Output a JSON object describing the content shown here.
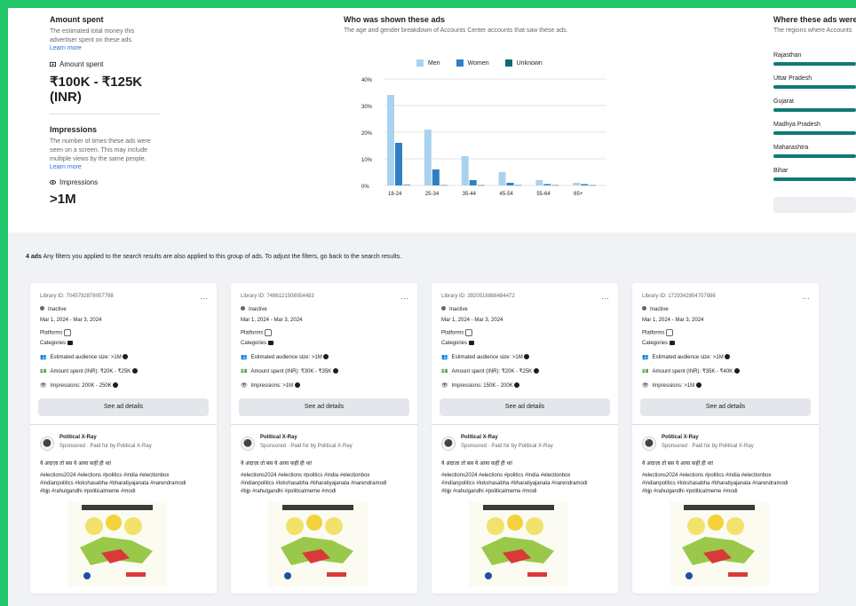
{
  "summary": {
    "amount_spent": {
      "title": "Amount spent",
      "description_1": "The estimated total money this",
      "description_2": "advertiser spent on these ads.",
      "learn_more": "Learn more",
      "label": "Amount spent",
      "value": "₹100K - ₹125K (INR)"
    },
    "impressions": {
      "title": "Impressions",
      "description_1": "The number of times these ads were",
      "description_2": "seen on a screen. This may include",
      "description_3": "multiple views by the same people.",
      "learn_more": "Learn more",
      "label": "Impressions",
      "value": ">1M"
    }
  },
  "chart": {
    "title": "Who was shown these ads",
    "subtitle": "The age and gender breakdown of Accounts Center accounts that saw these ads.",
    "legend": [
      "Men",
      "Women",
      "Unknown"
    ],
    "colors": {
      "Men": "#a9d2ef",
      "Women": "#2f7fc4",
      "Unknown": "#0e6a72",
      "grid": "#e4e6eb"
    }
  },
  "chart_data": {
    "type": "bar",
    "categories": [
      "18-24",
      "25-34",
      "35-44",
      "45-54",
      "55-64",
      "65+"
    ],
    "series": [
      {
        "name": "Men",
        "values": [
          34,
          21,
          11,
          5,
          2,
          1
        ]
      },
      {
        "name": "Women",
        "values": [
          16,
          6,
          2,
          1,
          0.5,
          0.5
        ]
      },
      {
        "name": "Unknown",
        "values": [
          0.2,
          0.1,
          0.1,
          0.1,
          0.1,
          0.1
        ]
      }
    ],
    "yticks": [
      "40%",
      "30%",
      "20%",
      "10%",
      "0%"
    ],
    "ylim": [
      0,
      40
    ],
    "grid": true,
    "legend_position": "top"
  },
  "regions": {
    "title": "Where these ads were",
    "subtitle": "The regions where Accounts",
    "items": [
      {
        "label": "Rajasthan"
      },
      {
        "label": "Uttar Pradesh"
      },
      {
        "label": "Gujarat"
      },
      {
        "label": "Madhya Pradesh"
      },
      {
        "label": "Maharashtra"
      },
      {
        "label": "Bihar"
      }
    ]
  },
  "filter_note": {
    "count": "4 ads",
    "text": "Any filters you applied to the search results are also applied to this group of ads. To adjust the filters, go back to the search results."
  },
  "cards": [
    {
      "library_id": "Library ID: 7045792878057798",
      "status": "Inactive",
      "dates": "Mar 1, 2024 - Mar 3, 2024",
      "platforms": "Platforms",
      "categories": "Categories",
      "audience": "Estimated audience size: >1M",
      "spent": "Amount spent (INR): ₹20K - ₹25K",
      "impressions": "Impressions: 200K - 250K",
      "details_button": "See ad details",
      "page_name": "Political X-Ray",
      "sponsored": "Sponsored · Paid for by Political X-Ray",
      "body": "ये अंदाज़ा तो बस ये आया कहीं ही था!",
      "hashtags_1": "#elections2024 #elections #politics #india #electionbox",
      "hashtags_2": "#indianpolitics #lokshasabha #bharatiyajanata #narendramodi",
      "hashtags_3": "#bjp #rahulgandhi #politicalmeme #modi"
    },
    {
      "library_id": "Library ID: 7486121508054483",
      "status": "Inactive",
      "dates": "Mar 1, 2024 - Mar 3, 2024",
      "platforms": "Platforms",
      "categories": "Categories",
      "audience": "Estimated audience size: >1M",
      "spent": "Amount spent (INR): ₹30K - ₹35K",
      "impressions": "Impressions: >1M",
      "details_button": "See ad details",
      "page_name": "Political X-Ray",
      "sponsored": "Sponsored · Paid for by Political X-Ray",
      "body": "ये अंदाज़ा तो बस ये आया कहीं ही था!",
      "hashtags_1": "#elections2024 #elections #politics #india #electionbox",
      "hashtags_2": "#indianpolitics #lokshasabha #bharatiyajanata #narendramodi",
      "hashtags_3": "#bjp #rahulgandhi #politicalmeme #modi"
    },
    {
      "library_id": "Library ID: 3920516888484472",
      "status": "Inactive",
      "dates": "Mar 1, 2024 - Mar 3, 2024",
      "platforms": "Platforms",
      "categories": "Categories",
      "audience": "Estimated audience size: >1M",
      "spent": "Amount spent (INR): ₹20K - ₹25K",
      "impressions": "Impressions: 150K - 200K",
      "details_button": "See ad details",
      "page_name": "Political X-Ray",
      "sponsored": "Sponsored · Paid for by Political X-Ray",
      "body": "ये अंदाज़ा तो बस ये आया कहीं ही था!",
      "hashtags_1": "#elections2024 #elections #politics #india #electionbox",
      "hashtags_2": "#indianpolitics #lokshasabha #bharatiyajanata #narendramodi",
      "hashtags_3": "#bjp #rahulgandhi #politicalmeme #modi"
    },
    {
      "library_id": "Library ID: 1729342804707986",
      "status": "Inactive",
      "dates": "Mar 1, 2024 - Mar 3, 2024",
      "platforms": "Platforms",
      "categories": "Categories",
      "audience": "Estimated audience size: >1M",
      "spent": "Amount spent (INR): ₹35K - ₹40K",
      "impressions": "Impressions: >1M",
      "details_button": "See ad details",
      "page_name": "Political X-Ray",
      "sponsored": "Sponsored · Paid for by Political X-Ray",
      "body": "ये अंदाज़ा तो बस ये आया कहीं ही था!",
      "hashtags_1": "#elections2024 #elections #politics #india #electionbox",
      "hashtags_2": "#indianpolitics #lokshasabha #bharatiyajanata #narendramodi",
      "hashtags_3": "#bjp #rahulgandhi #politicalmeme #modi"
    }
  ]
}
